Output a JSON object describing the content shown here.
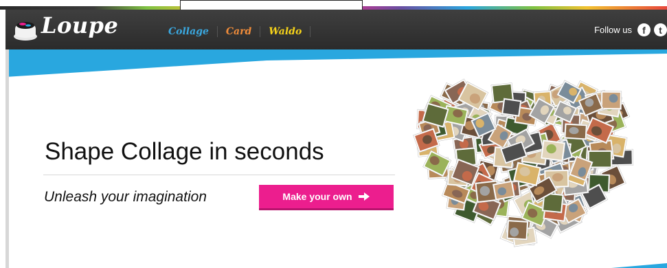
{
  "app": {
    "logo_text": "Loupe"
  },
  "nav": {
    "items": [
      {
        "label": "Collage"
      },
      {
        "label": "Card"
      },
      {
        "label": "Waldo"
      }
    ]
  },
  "social": {
    "follow_label": "Follow us",
    "icons": [
      "facebook-icon",
      "twitter-icon"
    ],
    "facebook_glyph": "f",
    "twitter_glyph": "t"
  },
  "hero": {
    "headline": "Shape Collage in seconds",
    "tagline": "Unleash your imagination",
    "cta_label": "Make your own",
    "cta_icon": "arrow-right-icon"
  },
  "colors": {
    "header_bg": "#333333",
    "accent_blue": "#29a7df",
    "cta_pink": "#ec1e8e",
    "nav_collage": "#3aa8e0",
    "nav_card": "#f08c3a",
    "nav_waldo": "#f5d21a"
  }
}
